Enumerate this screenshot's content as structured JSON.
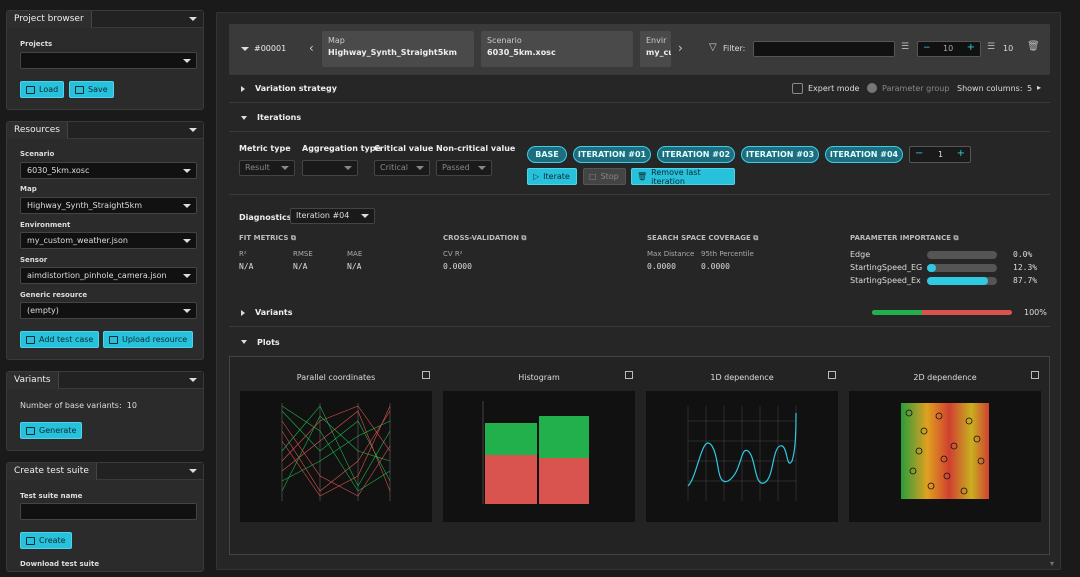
{
  "project": {
    "title": "Project browser",
    "projects_label": "Projects",
    "load": "Load",
    "save": "Save"
  },
  "resources": {
    "title": "Resources",
    "scenario_label": "Scenario",
    "scenario": "6030_5km.xosc",
    "map_label": "Map",
    "map": "Highway_Synth_Straight5km",
    "env_label": "Environment",
    "env": "my_custom_weather.json",
    "sensor_label": "Sensor",
    "sensor": "aimdistortion_pinhole_camera.json",
    "generic_label": "Generic resource",
    "generic": "(empty)",
    "add_test": "Add test case",
    "upload": "Upload resource"
  },
  "variants_panel": {
    "title": "Variants",
    "base_label": "Number of base variants:",
    "base_count": "10",
    "generate": "Generate"
  },
  "suite": {
    "title": "Create test suite",
    "name_label": "Test suite name",
    "create": "Create",
    "download": "Download test suite"
  },
  "top": {
    "id": "#00001",
    "cards": [
      {
        "a": "Map",
        "b": "Highway_Synth_Straight5km"
      },
      {
        "a": "Scenario",
        "b": "6030_5km.xosc"
      },
      {
        "a": "Envir",
        "b": "my_cu"
      }
    ],
    "filter": "Filter:",
    "stepper": "10",
    "count": "10"
  },
  "strategy": {
    "title": "Variation strategy",
    "expert": "Expert mode",
    "param_group": "Parameter group",
    "shown_cols": "Shown columns:",
    "cols": "5"
  },
  "iterations": {
    "title": "Iterations",
    "metric_type": "Metric type",
    "agg_type": "Aggregation type",
    "critical": "Critical value",
    "noncritical": "Non-critical value",
    "metric_val": "Result",
    "crit_val": "Critical",
    "noncrit_val": "Passed",
    "pills": [
      "BASE",
      "ITERATION #01",
      "ITERATION #02",
      "ITERATION #03",
      "ITERATION #04"
    ],
    "step": "1",
    "iterate": "Iterate",
    "stop": "Stop",
    "remove": "Remove last iteration"
  },
  "diag": {
    "title": "Diagnostics",
    "sel": "Iteration #04",
    "fit": "FIT METRICS",
    "r2": "R²",
    "rmse": "RMSE",
    "mae": "MAE",
    "na": "N/A",
    "cv": "CROSS-VALIDATION",
    "cvr2": "CV R²",
    "cvval": "0.0000",
    "ss": "SEARCH SPACE COVERAGE",
    "maxd": "Max Distance",
    "p95": "95th Percentile",
    "ssv": "0.0000",
    "pi": "PARAMETER IMPORTANCE",
    "params": [
      {
        "name": "Edge",
        "pct": "0.0%",
        "v": 0.0
      },
      {
        "name": "StartingSpeed_EG",
        "pct": "12.3%",
        "v": 0.123
      },
      {
        "name": "StartingSpeed_Ex",
        "pct": "87.7%",
        "v": 0.877
      }
    ]
  },
  "variants": {
    "title": "Variants",
    "pct": "100%",
    "green": 0.36
  },
  "plots": {
    "title": "Plots",
    "items": [
      "Parallel coordinates",
      "Histogram",
      "1D dependence",
      "2D dependence"
    ]
  },
  "colors": {
    "accent": "#27c1dc",
    "green": "#21b04b",
    "red": "#d9534f"
  }
}
